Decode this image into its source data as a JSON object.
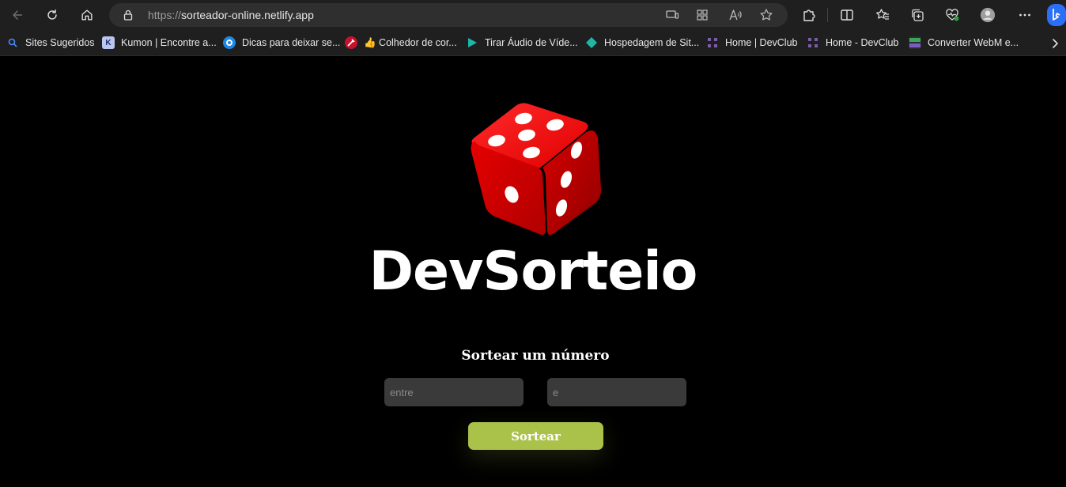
{
  "browser": {
    "url_scheme": "https://",
    "url_host": "sorteador-online.netlify.app"
  },
  "bookmarks": [
    {
      "label": "Sites Sugeridos",
      "fav_letter": ""
    },
    {
      "label": "Kumon | Encontre a...",
      "fav_letter": "K"
    },
    {
      "label": "Dicas para deixar se...",
      "fav_letter": ""
    },
    {
      "label": "👍 Colhedor de cor...",
      "fav_letter": ""
    },
    {
      "label": "Tirar Áudio de Víde...",
      "fav_letter": ""
    },
    {
      "label": "Hospedagem de Sit...",
      "fav_letter": ""
    },
    {
      "label": "Home | DevClub",
      "fav_letter": ""
    },
    {
      "label": "Home - DevClub",
      "fav_letter": ""
    },
    {
      "label": "Converter WebM e...",
      "fav_letter": ""
    }
  ],
  "main": {
    "brand": "DevSorteio",
    "subtitle": "Sortear um número",
    "min_placeholder": "entre",
    "max_placeholder": "e",
    "button_label": "Sortear"
  },
  "colors": {
    "accent": "#aac14a",
    "dice_red": "#d40000",
    "input_bg": "#3a3a3a",
    "chrome_bg": "#1f1f1f"
  }
}
